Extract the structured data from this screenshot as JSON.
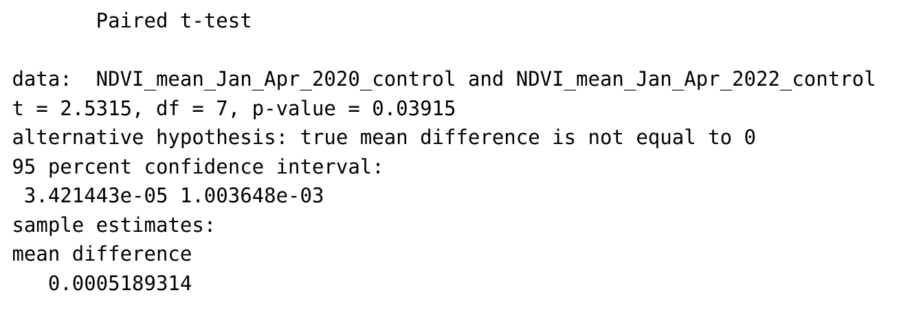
{
  "console": {
    "lines": [
      "        Paired t-test",
      " data:  NDVI_mean_Jan_Apr_2020_control and NDVI_mean_Jan_Apr_2022_control",
      " t = 2.5315, df = 7, p-value = 0.03915",
      " alternative hypothesis: true mean difference is not equal to 0",
      " 95 percent confidence interval:",
      "  3.421443e-05 1.003648e-03",
      " sample estimates:",
      " mean difference",
      "    0.0005189314"
    ]
  }
}
